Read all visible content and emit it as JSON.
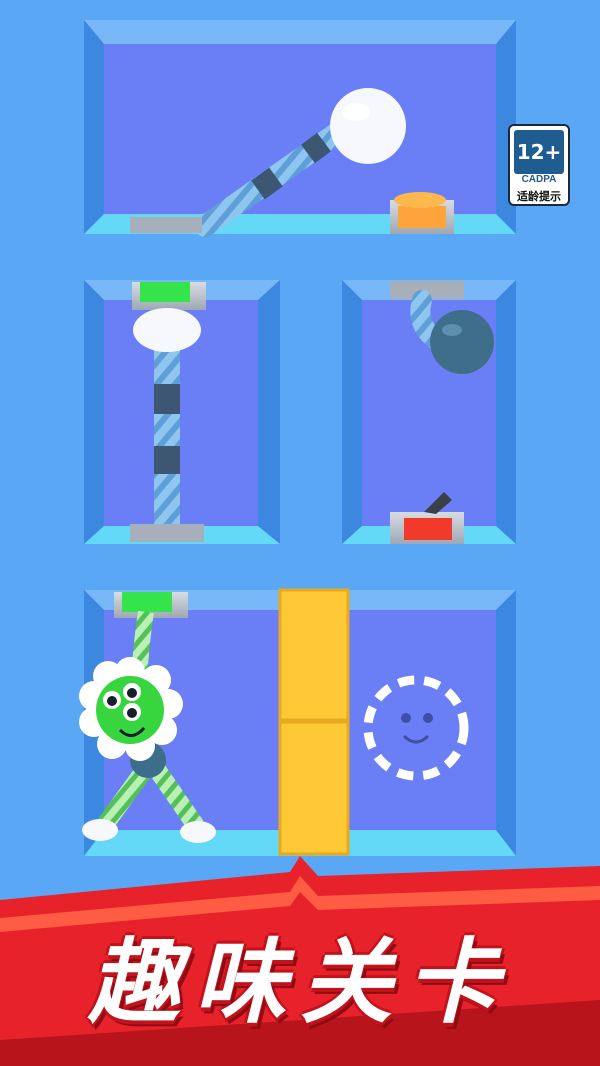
{
  "game": {
    "banner_title": "趣味关卡",
    "rating_badge": {
      "age": "12+",
      "org": "CADPA",
      "tip": "适龄提示"
    },
    "colors": {
      "background": "#5aa8f5",
      "room_back": "#6a7ff5",
      "room_floor": "#64d8f7",
      "green_button": "#35e34a",
      "orange_button": "#ffa43a",
      "red_button": "#f23a2a",
      "yellow_block": "#ffc935",
      "banner_red": "#e8222b"
    },
    "rooms": [
      {
        "name": "top-room",
        "items": [
          "rope",
          "white-ball",
          "orange-button"
        ]
      },
      {
        "name": "middle-left-room",
        "items": [
          "green-button",
          "white-ball",
          "rope"
        ]
      },
      {
        "name": "middle-right-room",
        "items": [
          "rope",
          "dark-ball",
          "red-button"
        ]
      },
      {
        "name": "bottom-room",
        "items": [
          "green-button",
          "flower-character",
          "yellow-blocks",
          "target-outline"
        ]
      }
    ]
  }
}
